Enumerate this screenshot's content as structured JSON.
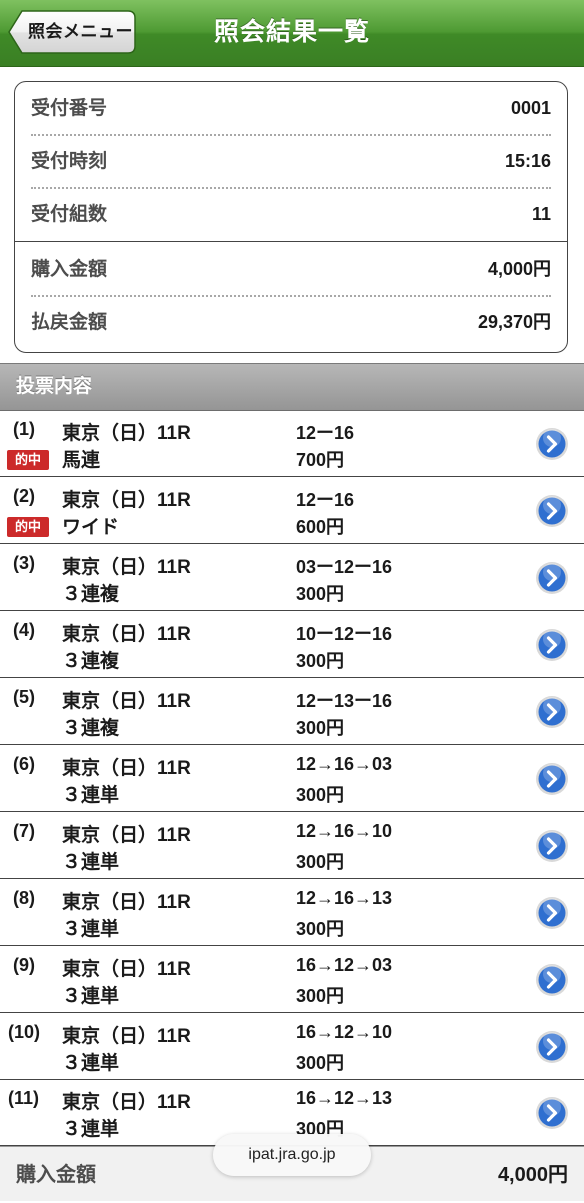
{
  "header": {
    "back_label": "照会メニュー",
    "title": "照会結果一覧"
  },
  "summary": {
    "rows": [
      {
        "label": "受付番号",
        "value": "0001"
      },
      {
        "label": "受付時刻",
        "value": "15:16"
      },
      {
        "label": "受付組数",
        "value": "11"
      },
      {
        "label": "購入金額",
        "value": "4,000円"
      },
      {
        "label": "払戻金額",
        "value": "29,370円"
      }
    ]
  },
  "section": {
    "title": "投票内容"
  },
  "bets": [
    {
      "no": "(1)",
      "race": "東京（日）11R",
      "type": "馬連",
      "combo": "12ー16",
      "amount": "700円",
      "hit": "的中"
    },
    {
      "no": "(2)",
      "race": "東京（日）11R",
      "type": "ワイド",
      "combo": "12ー16",
      "amount": "600円",
      "hit": "的中"
    },
    {
      "no": "(3)",
      "race": "東京（日）11R",
      "type": "３連複",
      "combo": "03ー12ー16",
      "amount": "300円",
      "hit": ""
    },
    {
      "no": "(4)",
      "race": "東京（日）11R",
      "type": "３連複",
      "combo": "10ー12ー16",
      "amount": "300円",
      "hit": ""
    },
    {
      "no": "(5)",
      "race": "東京（日）11R",
      "type": "３連複",
      "combo": "12ー13ー16",
      "amount": "300円",
      "hit": ""
    },
    {
      "no": "(6)",
      "race": "東京（日）11R",
      "type": "３連単",
      "combo": "12→16→03",
      "amount": "300円",
      "hit": ""
    },
    {
      "no": "(7)",
      "race": "東京（日）11R",
      "type": "３連単",
      "combo": "12→16→10",
      "amount": "300円",
      "hit": ""
    },
    {
      "no": "(8)",
      "race": "東京（日）11R",
      "type": "３連単",
      "combo": "12→16→13",
      "amount": "300円",
      "hit": ""
    },
    {
      "no": "(9)",
      "race": "東京（日）11R",
      "type": "３連単",
      "combo": "16→12→03",
      "amount": "300円",
      "hit": ""
    },
    {
      "no": "(10)",
      "race": "東京（日）11R",
      "type": "３連単",
      "combo": "16→12→10",
      "amount": "300円",
      "hit": ""
    },
    {
      "no": "(11)",
      "race": "東京（日）11R",
      "type": "３連単",
      "combo": "16→12→13",
      "amount": "300円",
      "hit": ""
    }
  ],
  "footer": {
    "label": "購入金額",
    "value": "4,000円"
  },
  "browser": {
    "url": "ipat.jra.go.jp"
  },
  "colors": {
    "header_green": "#4e9a33",
    "hit_badge": "#cc2a2a",
    "arrow_blue": "#2f6fd0",
    "section_gray": "#a6a6a6"
  },
  "icons": {
    "back": "back-arrow-button",
    "row_action": "chevron-right-circle-icon"
  }
}
